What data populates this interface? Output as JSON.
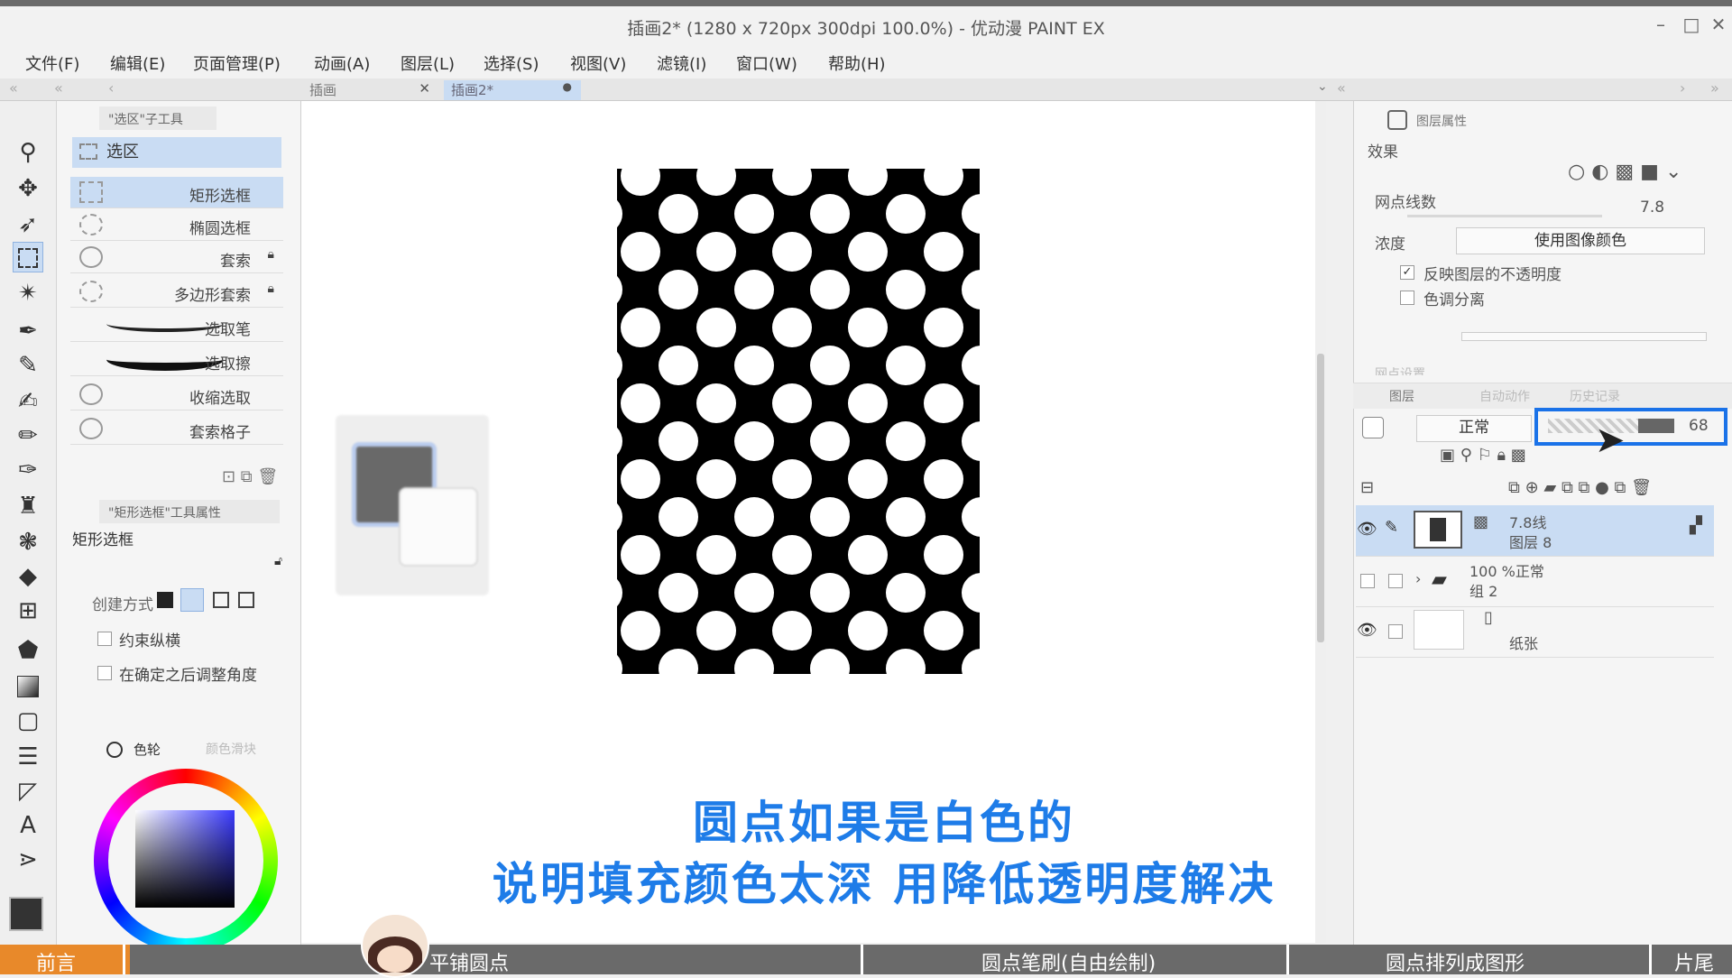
{
  "window": {
    "title": "插画2* (1280 x 720px 300dpi 100.0%)  - 优动漫 PAINT EX",
    "controls": [
      "–",
      "□",
      "✕"
    ]
  },
  "menu": [
    "文件(F)",
    "编辑(E)",
    "页面管理(P)",
    "动画(A)",
    "图层(L)",
    "选择(S)",
    "视图(V)",
    "滤镜(I)",
    "窗口(W)",
    "帮助(H)"
  ],
  "tabs": [
    {
      "label": "插画",
      "close": "✕"
    },
    {
      "label": "插画2*",
      "close": "●"
    }
  ],
  "toolbox": {
    "tools": [
      "zoom-icon",
      "move-icon",
      "object-select-icon",
      "marquee-icon",
      "magic-wand-icon",
      "pen-icon",
      "pencil-icon",
      "brush-icon",
      "airbrush-icon",
      "decoration-icon",
      "fill-bucket-icon",
      "blend-icon",
      "eraser-icon",
      "grid-icon",
      "fill-icon",
      "gradient-icon",
      "rectangle-icon",
      "frame-icon",
      "ruler-icon",
      "text-icon",
      "balloon-icon"
    ]
  },
  "subtool_panel": {
    "header": "\"选区\"子工具",
    "group": "选区",
    "items": [
      {
        "label": "矩形选框",
        "selected": true,
        "locked": false
      },
      {
        "label": "椭圆选框",
        "selected": false,
        "locked": false
      },
      {
        "label": "套索",
        "selected": false,
        "locked": true
      },
      {
        "label": "多边形套索",
        "selected": false,
        "locked": true
      },
      {
        "label": "选取笔",
        "selected": false,
        "locked": false
      },
      {
        "label": "选取擦",
        "selected": false,
        "locked": false
      },
      {
        "label": "收缩选取",
        "selected": false,
        "locked": false
      },
      {
        "label": "套索格子",
        "selected": false,
        "locked": false
      }
    ]
  },
  "tool_property": {
    "header": "\"矩形选框\"工具属性",
    "name": "矩形选框",
    "create_mode_label": "创建方式",
    "constrain_label": "约束纵横",
    "adjust_angle_label": "在确定之后调整角度"
  },
  "color_panel": {
    "tab_wheel": "色轮",
    "tab_slider": "颜色滑块"
  },
  "layer_property": {
    "header": "图层属性",
    "effect_label": "效果",
    "screen_lines_label": "网点线数",
    "screen_lines_value": "7.8",
    "density_label": "浓度",
    "density_value": "使用图像颜色",
    "reflect_opacity_label": "反映图层的不透明度",
    "reflect_opacity_checked": true,
    "posterize_label": "色调分离",
    "posterize_checked": false,
    "hidden_row": "网点设置"
  },
  "layer_panel": {
    "tabs": [
      "图层",
      "自动动作",
      "历史记录"
    ],
    "blend_mode": "正常",
    "opacity": "68",
    "layers": [
      {
        "line1": "7.8线",
        "line2": "图层 8",
        "visible": true,
        "selected": true
      },
      {
        "line1": "100 %正常",
        "line2": "组 2",
        "visible": false,
        "selected": false
      },
      {
        "line1": "",
        "line2": "纸张",
        "visible": true,
        "selected": false
      }
    ]
  },
  "subtitles": [
    "圆点如果是白色的",
    "说明填充颜色太深 用降低透明度解决"
  ],
  "chapters": {
    "items": [
      "前言",
      "平铺圆点",
      "圆点笔刷(自由绘制)",
      "圆点排列成图形",
      "片尾"
    ],
    "progress_percent": 7.5
  },
  "colors": {
    "accent": "#1e7ce8",
    "progress": "#e8892a",
    "selection": "#c9dcf3"
  }
}
